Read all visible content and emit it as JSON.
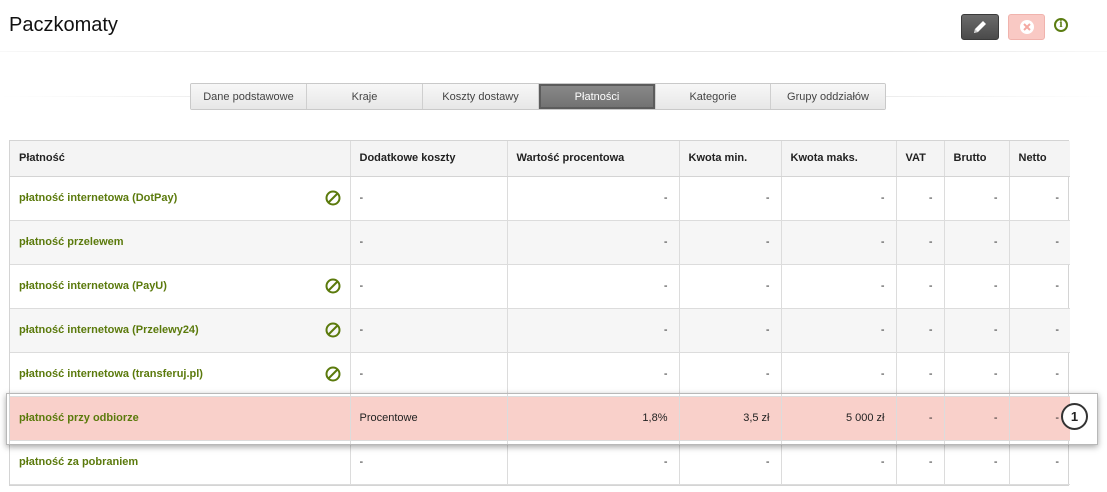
{
  "header": {
    "title": "Paczkomaty"
  },
  "toolbar": {
    "edit_icon": "pencil-icon",
    "delete_icon": "close-icon",
    "info_icon": "info-icon",
    "info_glyph": "i"
  },
  "colors": {
    "accent_green": "#5b7a0c",
    "highlight": "#f9d0ca",
    "active_tab": "#7a7a7a"
  },
  "tabs": [
    {
      "label": "Dane podstawowe",
      "active": false
    },
    {
      "label": "Kraje",
      "active": false
    },
    {
      "label": "Koszty dostawy",
      "active": false
    },
    {
      "label": "Płatności",
      "active": true
    },
    {
      "label": "Kategorie",
      "active": false
    },
    {
      "label": "Grupy oddziałów",
      "active": false
    }
  ],
  "table": {
    "headers": [
      "Płatność",
      "Dodatkowe koszty",
      "Wartość procentowa",
      "Kwota min.",
      "Kwota maks.",
      "VAT",
      "Brutto",
      "Netto"
    ],
    "rows": [
      {
        "name": "płatność internetowa (DotPay)",
        "blocked": true,
        "cells": [
          "-",
          "-",
          "-",
          "-",
          "-",
          "-",
          "-"
        ]
      },
      {
        "name": "płatność przelewem",
        "blocked": false,
        "cells": [
          "-",
          "-",
          "-",
          "-",
          "-",
          "-",
          "-"
        ]
      },
      {
        "name": "płatność internetowa (PayU)",
        "blocked": true,
        "cells": [
          "-",
          "-",
          "-",
          "-",
          "-",
          "-",
          "-"
        ]
      },
      {
        "name": "płatność internetowa (Przelewy24)",
        "blocked": true,
        "cells": [
          "-",
          "-",
          "-",
          "-",
          "-",
          "-",
          "-"
        ]
      },
      {
        "name": "płatność internetowa (transferuj.pl)",
        "blocked": true,
        "cells": [
          "-",
          "-",
          "-",
          "-",
          "-",
          "-",
          "-"
        ]
      },
      {
        "name": "płatność przy odbiorze",
        "blocked": false,
        "highlighted": true,
        "cells": [
          "Procentowe",
          "1,8%",
          "3,5  zł",
          "5 000  zł",
          "-",
          "-",
          "-"
        ]
      },
      {
        "name": "płatność za pobraniem",
        "blocked": false,
        "cells": [
          "-",
          "-",
          "-",
          "-",
          "-",
          "-",
          "-"
        ]
      }
    ]
  },
  "callout": {
    "label": "1"
  }
}
